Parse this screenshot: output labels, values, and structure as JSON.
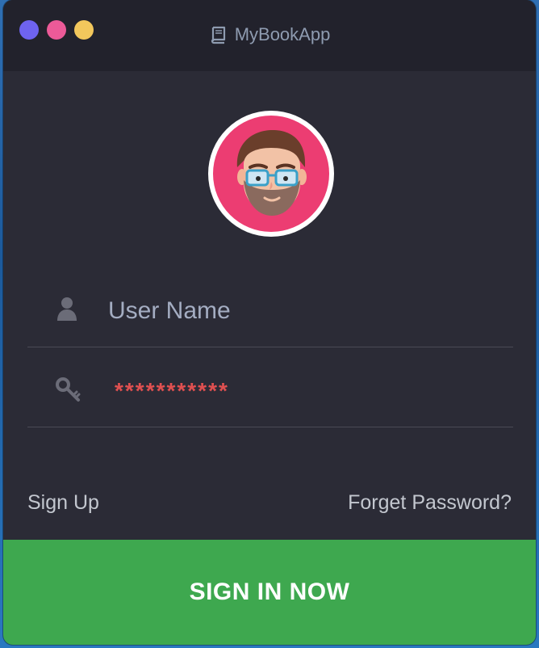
{
  "window": {
    "title": "MyBookApp",
    "title_icon": "book-icon",
    "traffic_lights": [
      {
        "name": "close",
        "color": "#6e63f0"
      },
      {
        "name": "minimize",
        "color": "#ec5a98"
      },
      {
        "name": "zoom",
        "color": "#f2c75c"
      }
    ]
  },
  "avatar": {
    "description_icon": "bearded-man-avatar",
    "ring_color": "#ec3d72"
  },
  "form": {
    "username": {
      "icon": "user-icon",
      "placeholder": "User Name",
      "value": ""
    },
    "password": {
      "icon": "key-icon",
      "value": "***********"
    }
  },
  "links": {
    "sign_up": "Sign Up",
    "forget_password": "Forget Password?"
  },
  "actions": {
    "sign_in": "SIGN IN NOW"
  },
  "colors": {
    "background": "#2b2b36",
    "titlebar": "#22222c",
    "accent_green": "#3ea84f",
    "password_red": "#e05050"
  }
}
